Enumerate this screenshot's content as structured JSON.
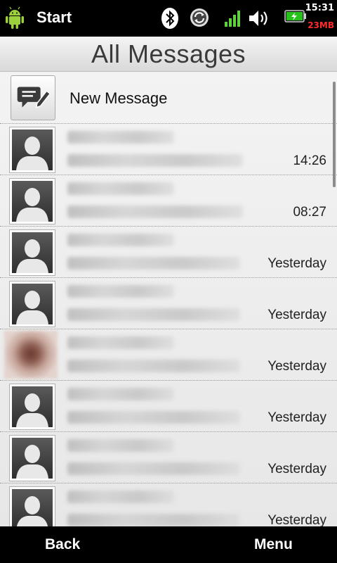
{
  "status_bar": {
    "app_name": "Start",
    "clock": "15:31",
    "memory": "23MB",
    "icons": [
      "android-icon",
      "bluetooth-icon",
      "sync-icon",
      "signal-icon",
      "volume-icon",
      "battery-icon"
    ]
  },
  "header": {
    "title": "All Messages"
  },
  "new_message": {
    "label": "New Message",
    "icon": "compose-icon"
  },
  "messages": [
    {
      "time": "14:26",
      "avatar": "default"
    },
    {
      "time": "08:27",
      "avatar": "default"
    },
    {
      "time": "Yesterday",
      "avatar": "default"
    },
    {
      "time": "Yesterday",
      "avatar": "default"
    },
    {
      "time": "Yesterday",
      "avatar": "photo"
    },
    {
      "time": "Yesterday",
      "avatar": "default"
    },
    {
      "time": "Yesterday",
      "avatar": "default"
    },
    {
      "time": "Yesterday",
      "avatar": "default"
    }
  ],
  "softkeys": {
    "back": "Back",
    "menu": "Menu"
  },
  "colors": {
    "memory_text": "#ff2a2a",
    "battery_fill": "#27c21b",
    "signal_green": "#5fd13a"
  }
}
